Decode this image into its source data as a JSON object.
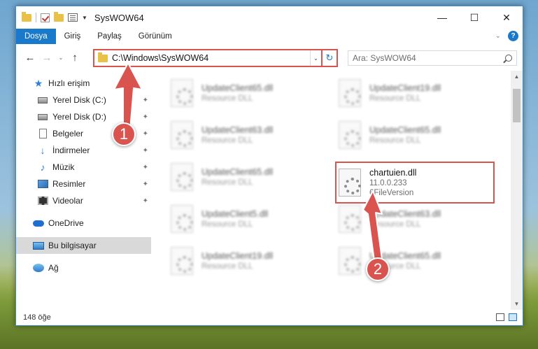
{
  "window": {
    "title": "SysWOW64",
    "controls": {
      "minimize": "—",
      "maximize": "☐",
      "close": "✕"
    }
  },
  "ribbon": {
    "tabs": [
      "Dosya",
      "Giriş",
      "Paylaş",
      "Görünüm"
    ],
    "active_tab": "Dosya",
    "expand_glyph": "⌄",
    "help_glyph": "?"
  },
  "address": {
    "path": "C:\\Windows\\SysWOW64",
    "search_placeholder": "Ara: SysWOW64",
    "back": "←",
    "forward": "→",
    "recent": "⌄",
    "up": "↑",
    "dropdown": "⌄",
    "refresh": "↻"
  },
  "nav": {
    "items": [
      {
        "label": "Hızlı erişim",
        "icon": "star-icon"
      },
      {
        "label": "Yerel Disk (C:)",
        "icon": "drive-icon"
      },
      {
        "label": "Yerel Disk (D:)",
        "icon": "drive-icon"
      },
      {
        "label": "Belgeler",
        "icon": "documents-icon"
      },
      {
        "label": "İndirmeler",
        "icon": "download-icon"
      },
      {
        "label": "Müzik",
        "icon": "music-icon"
      },
      {
        "label": "Resimler",
        "icon": "pictures-icon"
      },
      {
        "label": "Videolar",
        "icon": "videos-icon"
      },
      {
        "label": "OneDrive",
        "icon": "cloud-icon"
      },
      {
        "label": "Bu bilgisayar",
        "icon": "computer-icon"
      },
      {
        "label": "Ağ",
        "icon": "network-icon"
      }
    ],
    "pin_glyph": "✦"
  },
  "files": {
    "left": [
      {
        "name": "UpdateClient65.dll",
        "desc": "Resource DLL"
      },
      {
        "name": "UpdateClient63.dll",
        "desc": "Resource DLL"
      },
      {
        "name": "UpdateClient65.dll",
        "desc": "Resource DLL"
      },
      {
        "name": "UpdateClient5.dll",
        "desc": "Resource DLL"
      },
      {
        "name": "UpdateClient19.dll",
        "desc": "Resource DLL"
      }
    ],
    "right": [
      {
        "name": "UpdateClient19.dll",
        "desc": "Resource DLL"
      },
      {
        "name": "UpdateClient65.dll",
        "desc": "Resource DLL"
      },
      {
        "name": "chartuien.dll",
        "version": "11.0.0.233",
        "desc": "6FileVersion"
      },
      {
        "name": "UpdateClient63.dll",
        "desc": "Resource DLL"
      },
      {
        "name": "UpdateClient65.dll",
        "desc": "Resource DLL"
      }
    ]
  },
  "status": {
    "count": "148 öğe"
  },
  "annotations": {
    "step1": "1",
    "step2": "2",
    "color": "#d9534f"
  },
  "colors": {
    "accent": "#1979ca",
    "highlight": "#d9534f"
  }
}
